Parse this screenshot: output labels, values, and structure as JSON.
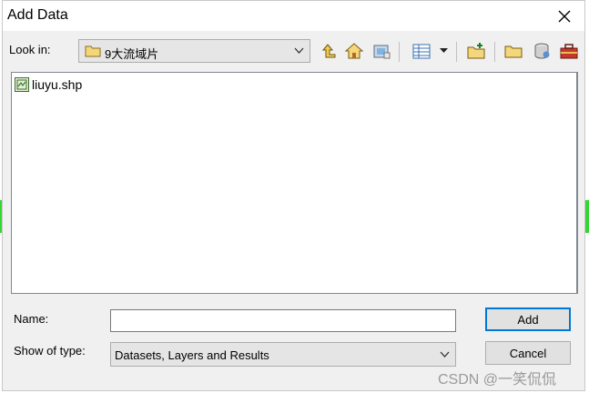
{
  "window": {
    "title": "Add Data"
  },
  "toolbar": {
    "look_in_label": "Look in:",
    "current_folder": "9大流域片",
    "buttons": [
      "up-one-level-icon",
      "home-icon",
      "catalog-connect-icon",
      "details-view-icon",
      "view-dropdown-icon",
      "new-folder-icon",
      "folder-connections-icon",
      "geodatabase-icon",
      "toolbox-icon"
    ]
  },
  "file_list": {
    "items": [
      {
        "name": "liuyu.shp",
        "icon": "shapefile-icon"
      }
    ]
  },
  "form": {
    "name_label": "Name:",
    "name_value": "",
    "type_label": "Show of type:",
    "type_value": "Datasets, Layers and Results"
  },
  "buttons": {
    "add": "Add",
    "cancel": "Cancel"
  },
  "watermark": "CSDN @一笑侃侃",
  "colors": {
    "accent": "#0078d7",
    "background_strip": "#33d633"
  }
}
